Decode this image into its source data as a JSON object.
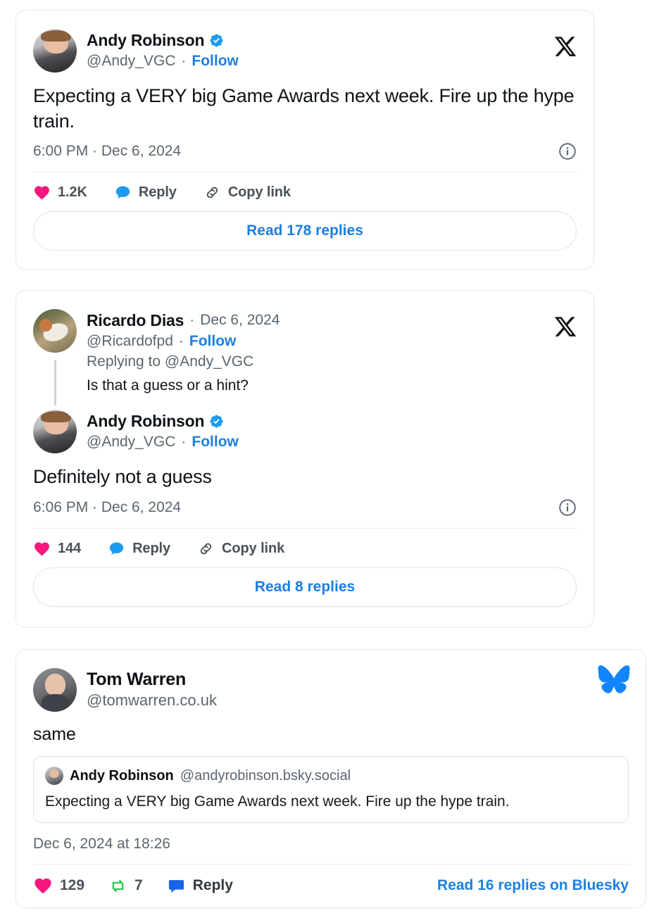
{
  "tweet1": {
    "platform_logo": "x-logo",
    "author": {
      "display_name": "Andy Robinson",
      "verified_badge": "verified-badge-icon",
      "handle": "@Andy_VGC",
      "separator": "·",
      "follow_label": "Follow"
    },
    "text": "Expecting a VERY big Game Awards next week. Fire up the hype train.",
    "timestamp": "6:00 PM · Dec 6, 2024",
    "info_icon": "info-icon",
    "actions": {
      "like_icon": "heart-icon",
      "like_count": "1.2K",
      "reply_icon": "speech-bubble-icon",
      "reply_label": "Reply",
      "copy_icon": "link-icon",
      "copy_label": "Copy link"
    },
    "read_replies_label": "Read 178 replies"
  },
  "tweet2": {
    "platform_logo": "x-logo",
    "reply_author": {
      "display_name": "Ricardo Dias",
      "separator": "·",
      "date": "Dec 6, 2024",
      "handle": "@Ricardofpd",
      "follow_label": "Follow",
      "replying_to": "Replying to @Andy_VGC"
    },
    "reply_text": "Is that a guess or a hint?",
    "author": {
      "display_name": "Andy Robinson",
      "verified_badge": "verified-badge-icon",
      "handle": "@Andy_VGC",
      "separator": "·",
      "follow_label": "Follow"
    },
    "text": "Definitely not a guess",
    "timestamp": "6:06 PM · Dec 6, 2024",
    "info_icon": "info-icon",
    "actions": {
      "like_icon": "heart-icon",
      "like_count": "144",
      "reply_icon": "speech-bubble-icon",
      "reply_label": "Reply",
      "copy_icon": "link-icon",
      "copy_label": "Copy link"
    },
    "read_replies_label": "Read 8 replies"
  },
  "bluesky": {
    "platform_logo": "bluesky-butterfly-icon",
    "author": {
      "display_name": "Tom Warren",
      "handle": "@tomwarren.co.uk"
    },
    "text": "same",
    "quote": {
      "display_name": "Andy Robinson",
      "handle": "@andyrobinson.bsky.social",
      "text": "Expecting a VERY big Game Awards next week. Fire up the hype train."
    },
    "timestamp": "Dec 6, 2024 at 18:26",
    "actions": {
      "like_icon": "heart-icon",
      "like_count": "129",
      "repost_icon": "repost-icon",
      "repost_count": "7",
      "reply_icon": "speech-bubble-icon",
      "reply_label": "Reply"
    },
    "read_replies_label": "Read 16 replies on Bluesky"
  },
  "colors": {
    "link_blue": "#1d7fe0",
    "like_pink": "#f6177f",
    "reply_blue_x": "#1d9bf0",
    "reply_blue_bsky": "#1764e8",
    "repost_green": "#29cc4b",
    "bluesky_brand": "#1185fe",
    "verified_blue": "#1d9bf0",
    "text_primary": "#0f1419",
    "text_muted": "#5b6570",
    "card_border": "#e6e7e8"
  }
}
